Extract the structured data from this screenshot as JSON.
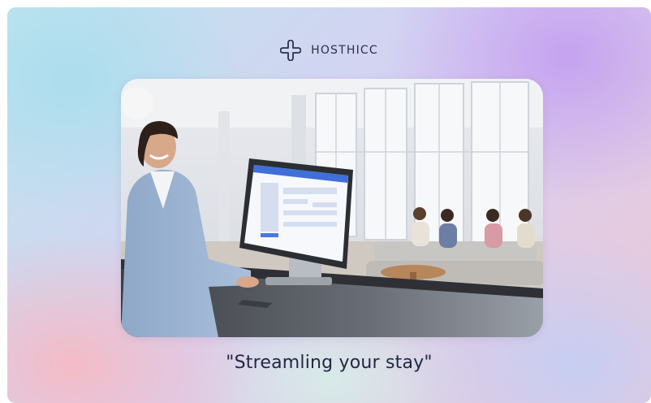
{
  "brand": {
    "name": "HOSTHICC",
    "logo_icon": "quatrefoil-logo-icon"
  },
  "hero_image": {
    "subject": "receptionist-at-check-in-kiosk-in-hotel-lobby"
  },
  "tagline": "\"Streamling your stay\"",
  "colors": {
    "text": "#232841",
    "gradient_top_left": "#aadeee",
    "gradient_top_right": "#c4a0f0",
    "gradient_bottom_left": "#f6bac4",
    "gradient_bottom_right": "#c4cef4"
  }
}
